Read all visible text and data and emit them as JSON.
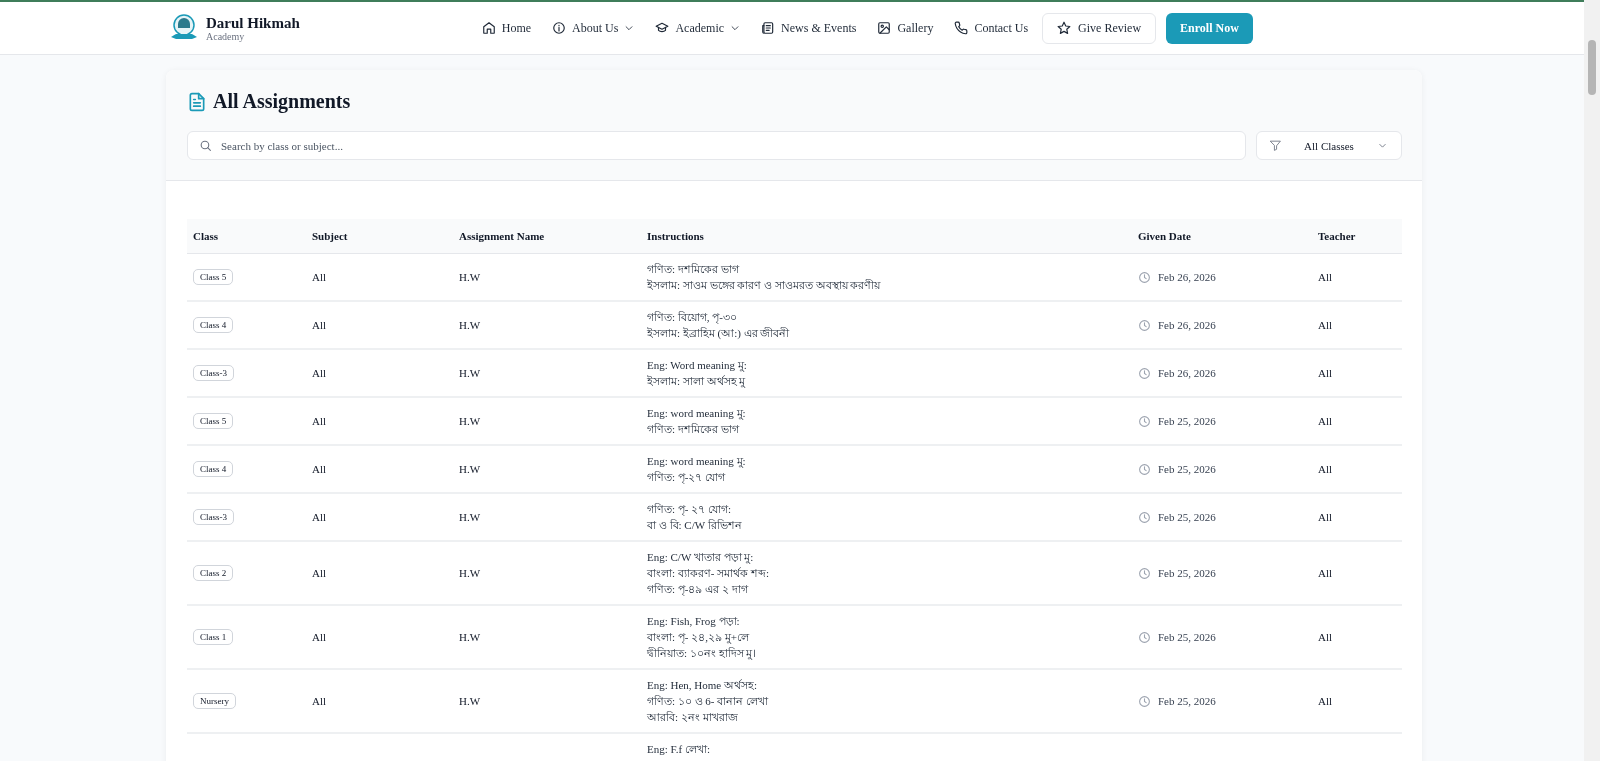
{
  "header": {
    "brand": {
      "name": "Darul Hikmah",
      "tagline": "Academy"
    },
    "nav": [
      {
        "label": "Home",
        "dropdown": false
      },
      {
        "label": "About Us",
        "dropdown": true
      },
      {
        "label": "Academic",
        "dropdown": true
      },
      {
        "label": "News & Events",
        "dropdown": false
      },
      {
        "label": "Gallery",
        "dropdown": false
      },
      {
        "label": "Contact Us",
        "dropdown": false
      }
    ],
    "review_button": "Give Review",
    "enroll_button": "Enroll Now"
  },
  "page": {
    "title": "All Assignments",
    "search": {
      "placeholder": "Search by class or subject..."
    },
    "class_filter": {
      "value": "All Classes"
    }
  },
  "table": {
    "columns": [
      "Class",
      "Subject",
      "Assignment Name",
      "Instructions",
      "Given Date",
      "Teacher"
    ],
    "rows": [
      {
        "class": "Class 5",
        "subject": "All",
        "name": "H.W",
        "instructions": [
          "গণিত: দশমিকের ভাগ",
          "ইসলাম: সাওম ভঙ্গের কারণ ও সাওমরত অবস্থায় করণীয়"
        ],
        "date": "Feb 26, 2026",
        "teacher": "All"
      },
      {
        "class": "Class 4",
        "subject": "All",
        "name": "H.W",
        "instructions": [
          "গণিত: বিয়োগ, পৃ-৩০",
          "ইসলাম: ইব্রাহিম (আ:) এর জীবনী"
        ],
        "date": "Feb 26, 2026",
        "teacher": "All"
      },
      {
        "class": "Class-3",
        "subject": "All",
        "name": "H.W",
        "instructions": [
          "Eng: Word meaning মু:",
          "ইসলাম: সালা অর্থসহ মু"
        ],
        "date": "Feb 26, 2026",
        "teacher": "All"
      },
      {
        "class": "Class 5",
        "subject": "All",
        "name": "H.W",
        "instructions": [
          "Eng: word meaning মু:",
          "গণিত: দশমিকের ভাগ"
        ],
        "date": "Feb 25, 2026",
        "teacher": "All"
      },
      {
        "class": "Class 4",
        "subject": "All",
        "name": "H.W",
        "instructions": [
          "Eng: word meaning মু:",
          "গণিত: পৃ-২৭ যোগ"
        ],
        "date": "Feb 25, 2026",
        "teacher": "All"
      },
      {
        "class": "Class-3",
        "subject": "All",
        "name": "H.W",
        "instructions": [
          "গণিত: পৃ- ২৭ যোগ:",
          "বা ও বি: C/W রিভিশন"
        ],
        "date": "Feb 25, 2026",
        "teacher": "All"
      },
      {
        "class": "Class 2",
        "subject": "All",
        "name": "H.W",
        "instructions": [
          "Eng: C/W খাতার পড়া মু:",
          "বাংলা: ব্যাকরণ- সমার্থক শব্দ:",
          "গণিত: পৃ-৪৯ এর ২ দাগ"
        ],
        "date": "Feb 25, 2026",
        "teacher": "All"
      },
      {
        "class": "Class 1",
        "subject": "All",
        "name": "H.W",
        "instructions": [
          "Eng: Fish, Frog পড়া:",
          "বাংলা: পৃ- ২৪,২৯ মু+লে",
          "দ্বীনিয়াত: ১০নং হাদিস মু।"
        ],
        "date": "Feb 25, 2026",
        "teacher": "All"
      },
      {
        "class": "Nursery",
        "subject": "All",
        "name": "H.W",
        "instructions": [
          "Eng: Hen, Home অর্থসহ:",
          "গণিত: ১০ ও 6- বানান লেখা",
          "আরবি: ২নং মাখরাজ"
        ],
        "date": "Feb 25, 2026",
        "teacher": "All"
      },
      {
        "instructions": [
          "Eng: F.f লেখা:"
        ]
      }
    ]
  }
}
